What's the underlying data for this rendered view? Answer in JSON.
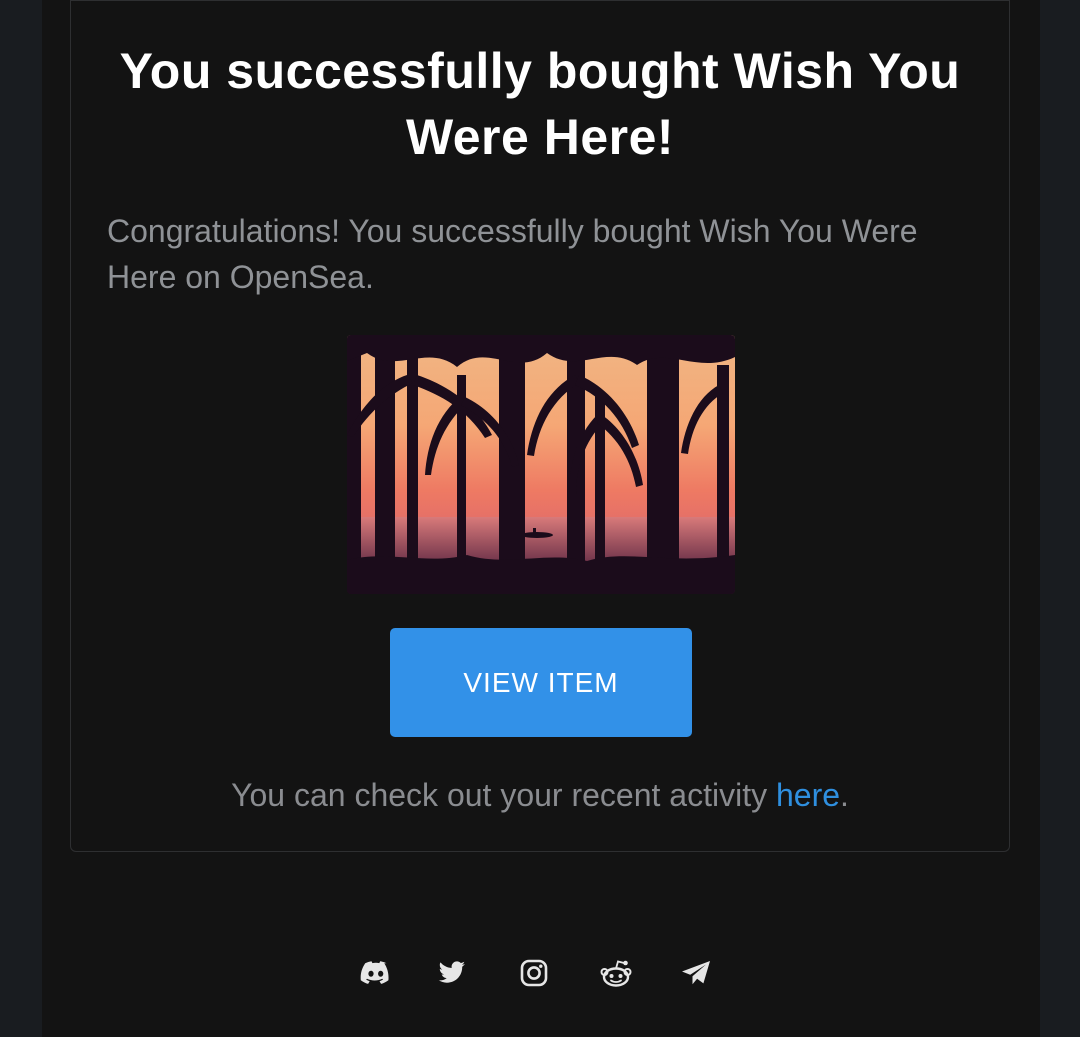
{
  "email": {
    "title": "You successfully bought Wish You Were Here!",
    "message": "Congratulations! You successfully bought Wish You Were Here on OpenSea.",
    "image": {
      "icon": "palm-trees-sunset-image"
    },
    "button_label": "VIEW ITEM",
    "activity_prefix": "You can check out your recent activity ",
    "activity_link": "here",
    "activity_suffix": "."
  },
  "footer": {
    "social_icons": [
      "discord-icon",
      "twitter-icon",
      "instagram-icon",
      "reddit-icon",
      "telegram-icon"
    ]
  },
  "colors": {
    "background": "#191c20",
    "panel": "#131313",
    "button": "#3291e8",
    "link": "#2f8fdf",
    "body_text": "#8f9296"
  }
}
